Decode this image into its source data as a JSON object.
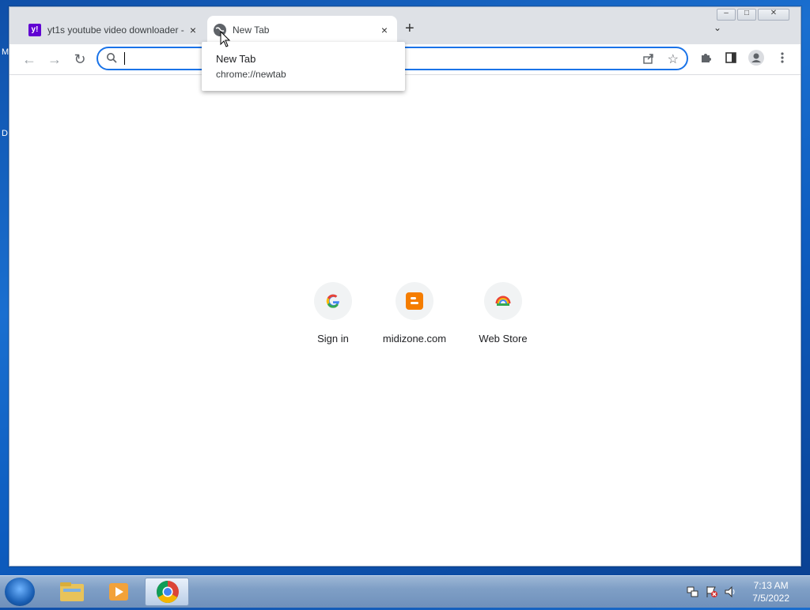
{
  "desktop": {
    "hint_left_top": "M",
    "hint_left_mid": "D"
  },
  "window": {
    "tabs": [
      {
        "title": "yt1s youtube video downloader -",
        "favicon": "yahoo-icon",
        "close": "×"
      },
      {
        "title": "New Tab",
        "favicon": "globe-icon",
        "close": "×"
      }
    ],
    "new_tab_glyph": "+",
    "tab_search_glyph": "⌄",
    "controls": {
      "minimize": "–",
      "maximize": "□",
      "close": "✕"
    }
  },
  "toolbar": {
    "back_glyph": "←",
    "forward_glyph": "→",
    "reload_glyph": "↻",
    "omnibox_value": "",
    "star_glyph": "☆"
  },
  "dropdown": {
    "title": "New Tab",
    "url": "chrome://newtab"
  },
  "shortcuts": [
    {
      "label": "Sign in",
      "icon": "google-icon"
    },
    {
      "label": "midizone.com",
      "icon": "blogger-icon"
    },
    {
      "label": "Web Store",
      "icon": "webstore-icon"
    }
  ],
  "taskbar": {
    "items": [
      "file-explorer-icon",
      "media-player-icon",
      "chrome-icon"
    ],
    "time": "7:13 AM",
    "date": "7/5/2022"
  },
  "colors": {
    "accent": "#1a73e8",
    "tabstrip": "#dee1e6"
  }
}
